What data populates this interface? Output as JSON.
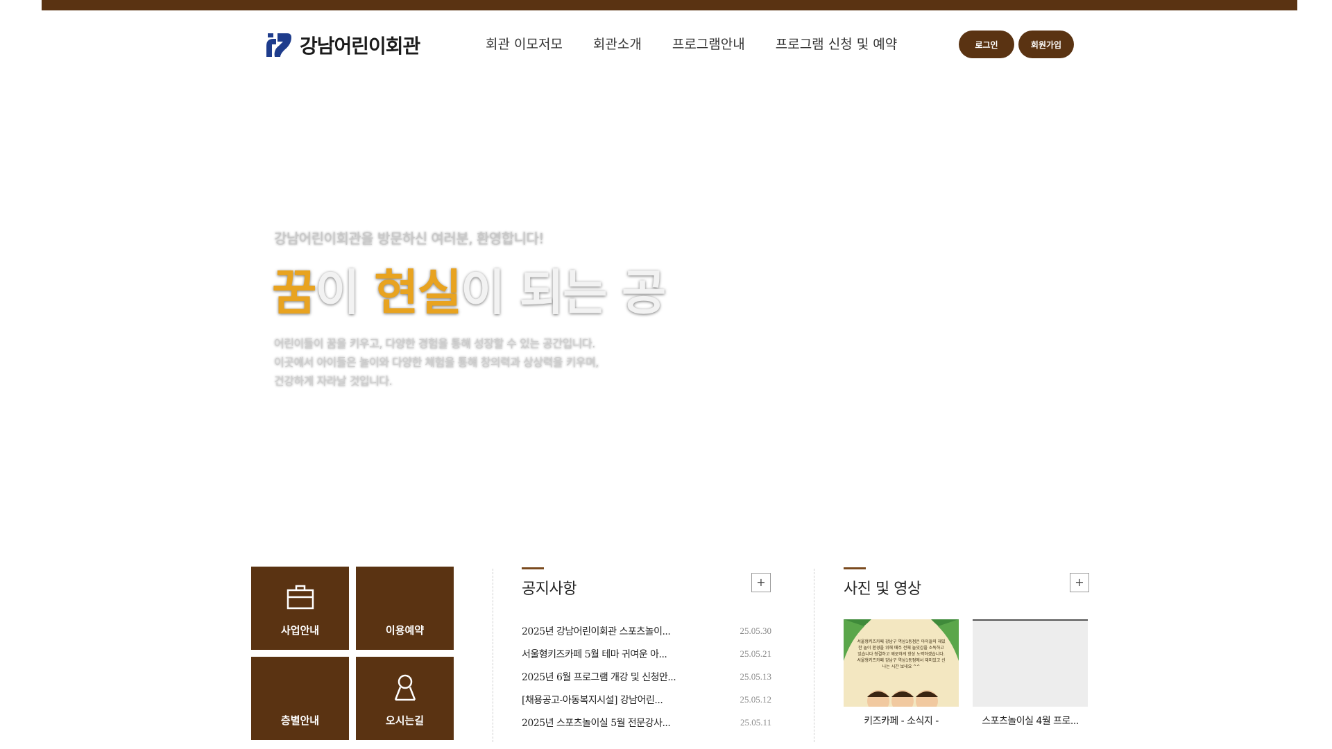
{
  "header": {
    "logo_text": "강남어린이회관",
    "nav": [
      "회관 이모저모",
      "회관소개",
      "프로그램안내",
      "프로그램 신청 및 예약"
    ],
    "login_label": "로그인",
    "join_label": "회원가입"
  },
  "hero": {
    "greeting": "강남어린이회관을 방문하신 여러분, 환영합니다!",
    "title_accent1": "꿈",
    "title_part1": "이 ",
    "title_accent2": "현실",
    "title_part2": "이 되는 공",
    "desc_line1": "어린이들이 꿈을 키우고, 다양한 경험을 통해 성장할 수 있는 공간입니다.",
    "desc_line2": "이곳에서 아이들은 놀이와 다양한 체험을 통해 창의력과 상상력을 키우며,",
    "desc_line3": "건강하게 자라날 것입니다."
  },
  "quick_links": [
    {
      "label": "사업안내",
      "icon": "briefcase-icon"
    },
    {
      "label": "이용예약",
      "icon": ""
    },
    {
      "label": "층별안내",
      "icon": ""
    },
    {
      "label": "오시는길",
      "icon": "location-person-icon"
    }
  ],
  "notice": {
    "title": "공지사항",
    "more": "+",
    "items": [
      {
        "title": "2025년 강남어린이회관 스포츠놀이...",
        "date": "25.05.30"
      },
      {
        "title": "서울형키즈카페 5월 테마 귀여운 아...",
        "date": "25.05.21"
      },
      {
        "title": "2025년 6월 프로그램 개강 및 신청안...",
        "date": "25.05.13"
      },
      {
        "title": "[채용공고-아동복지시설] 강남어린...",
        "date": "25.05.12"
      },
      {
        "title": "2025년 스포츠놀이실 5월 전문강사...",
        "date": "25.05.11"
      }
    ]
  },
  "gallery": {
    "title": "사진 및 영상",
    "more": "+",
    "items": [
      {
        "caption": "키즈카페 - 소식지 -",
        "poster_text": "서울형키즈카페 강남구 역삼1동점은 아이들의 재밌한 놀이 환경을 위해 매주 전체 놀잇감을 소독하고 있습니다 청결하고 깨끗하게 항상 노력하겠습니다. 서울형키즈카페 강남구 역삼1동점에서 재미있고 신나는 시간 보내요 ^^"
      },
      {
        "caption": "스포츠놀이실 4월 프로..."
      }
    ]
  },
  "colors": {
    "brand_brown": "#5a3312",
    "accent_orange": "#e8a320",
    "logo_navy": "#1e3c8c"
  }
}
